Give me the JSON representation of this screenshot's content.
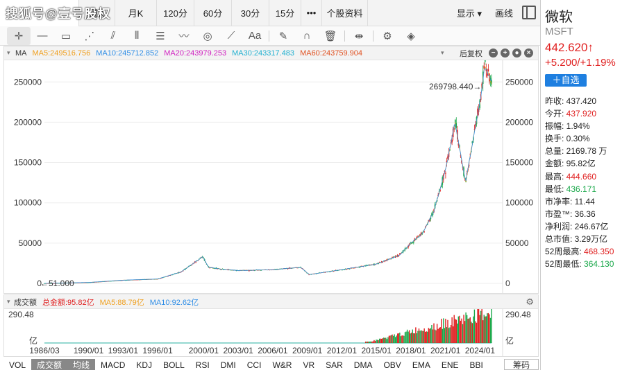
{
  "watermark": "搜狐号@壹号股权",
  "period_tabs": [
    {
      "label": "周K",
      "w": 52
    },
    {
      "label": "月K",
      "w": 60
    },
    {
      "label": "120分",
      "w": 54
    },
    {
      "label": "60分",
      "w": 54
    },
    {
      "label": "30分",
      "w": 54
    },
    {
      "label": "15分",
      "w": 46
    },
    {
      "label": "•••",
      "w": 30
    },
    {
      "label": "个股资料",
      "w": 66
    }
  ],
  "top_right": {
    "display_label": "显示 ▾",
    "draw_label": "画线"
  },
  "ma_bar": {
    "label": "MA",
    "items": [
      {
        "text": "MA5:249516.756",
        "color": "#f0a020"
      },
      {
        "text": "MA10:245712.852",
        "color": "#2e8de6"
      },
      {
        "text": "MA20:243979.253",
        "color": "#d020c0"
      },
      {
        "text": "MA30:243317.483",
        "color": "#20b0d0"
      },
      {
        "text": "MA60:243759.904",
        "color": "#e05020"
      }
    ],
    "fuquan": "后复权"
  },
  "axis": {
    "y_ticks": [
      "250000",
      "200000",
      "150000",
      "100000",
      "50000",
      "0"
    ],
    "x_ticks": [
      "1986/03",
      "1990/01",
      "1993/01",
      "1996/01",
      "2000/01",
      "2003/01",
      "2006/01",
      "2009/01",
      "2012/01",
      "2015/01",
      "2018/01",
      "2021/01",
      "2024/01"
    ],
    "max_label": "269798.440→",
    "min_label": "←51.000",
    "vol_top": "290.48",
    "vol_unit": "亿"
  },
  "chart_data": {
    "type": "line",
    "title": "",
    "xlabel": "",
    "ylabel": "",
    "ylim": [
      0,
      270000
    ],
    "x": [
      "1986/03",
      "1990/01",
      "1993/01",
      "1996/01",
      "1998/01",
      "1999/12",
      "2000/06",
      "2001/06",
      "2003/01",
      "2006/01",
      "2008/06",
      "2009/03",
      "2012/01",
      "2015/01",
      "2017/01",
      "2018/01",
      "2019/01",
      "2020/01",
      "2021/01",
      "2021/11",
      "2022/10",
      "2023/06",
      "2024/01",
      "2024/06",
      "2025/01"
    ],
    "series": [
      {
        "name": "",
        "values": [
          51,
          1200,
          4000,
          5500,
          14000,
          33000,
          20000,
          18000,
          16000,
          17000,
          20000,
          11000,
          17000,
          24000,
          35000,
          50000,
          62000,
          90000,
          140000,
          200000,
          125000,
          180000,
          225000,
          269798,
          250000
        ]
      }
    ],
    "volume": {
      "ylim": [
        0,
        290.48
      ],
      "unit": "亿"
    }
  },
  "vol_bar": {
    "label": "成交额",
    "items": [
      {
        "text": "总金额:95.82亿",
        "color": "#e02020"
      },
      {
        "text": "MA5:88.79亿",
        "color": "#f0a020"
      },
      {
        "text": "MA10:92.62亿",
        "color": "#2e8de6"
      }
    ]
  },
  "indicators": [
    {
      "label": "VOL",
      "on": false
    },
    {
      "label": "成交额",
      "on": true
    },
    {
      "label": "均线",
      "on": true
    },
    {
      "label": "MACD",
      "on": false
    },
    {
      "label": "KDJ",
      "on": false
    },
    {
      "label": "BOLL",
      "on": false
    },
    {
      "label": "RSI",
      "on": false
    },
    {
      "label": "DMI",
      "on": false
    },
    {
      "label": "CCI",
      "on": false
    },
    {
      "label": "W&R",
      "on": false
    },
    {
      "label": "VR",
      "on": false
    },
    {
      "label": "SAR",
      "on": false
    },
    {
      "label": "DMA",
      "on": false
    },
    {
      "label": "OBV",
      "on": false
    },
    {
      "label": "EMA",
      "on": false
    },
    {
      "label": "ENE",
      "on": false
    },
    {
      "label": "BBI",
      "on": false
    }
  ],
  "chouma": "筹码",
  "quote": {
    "name": "微软",
    "code": "MSFT",
    "price": "442.620↑",
    "change": "+5.200/+1.19%",
    "add_label": "＋自选",
    "rows": [
      {
        "label": "昨收:",
        "value": "437.420",
        "color": ""
      },
      {
        "label": "今开:",
        "value": "437.920",
        "color": "red"
      },
      {
        "label": "振幅:",
        "value": "1.94%",
        "color": ""
      },
      {
        "label": "换手:",
        "value": "0.30%",
        "color": ""
      },
      {
        "label": "总量:",
        "value": "2169.78 万",
        "color": ""
      },
      {
        "label": "金额:",
        "value": "95.82亿",
        "color": ""
      },
      {
        "label": "最高:",
        "value": "444.660",
        "color": "red"
      },
      {
        "label": "最低:",
        "value": "436.171",
        "color": "green"
      },
      {
        "label": "市净率:",
        "value": "11.44",
        "color": ""
      },
      {
        "label": "市盈™:",
        "value": "36.36",
        "color": ""
      },
      {
        "label": "净利润:",
        "value": "246.67亿",
        "color": ""
      },
      {
        "label": "总市值:",
        "value": "3.29万亿",
        "color": ""
      },
      {
        "label": "52周最高:",
        "value": "468.350",
        "color": "red"
      },
      {
        "label": "52周最低:",
        "value": "364.130",
        "color": "green"
      }
    ]
  }
}
